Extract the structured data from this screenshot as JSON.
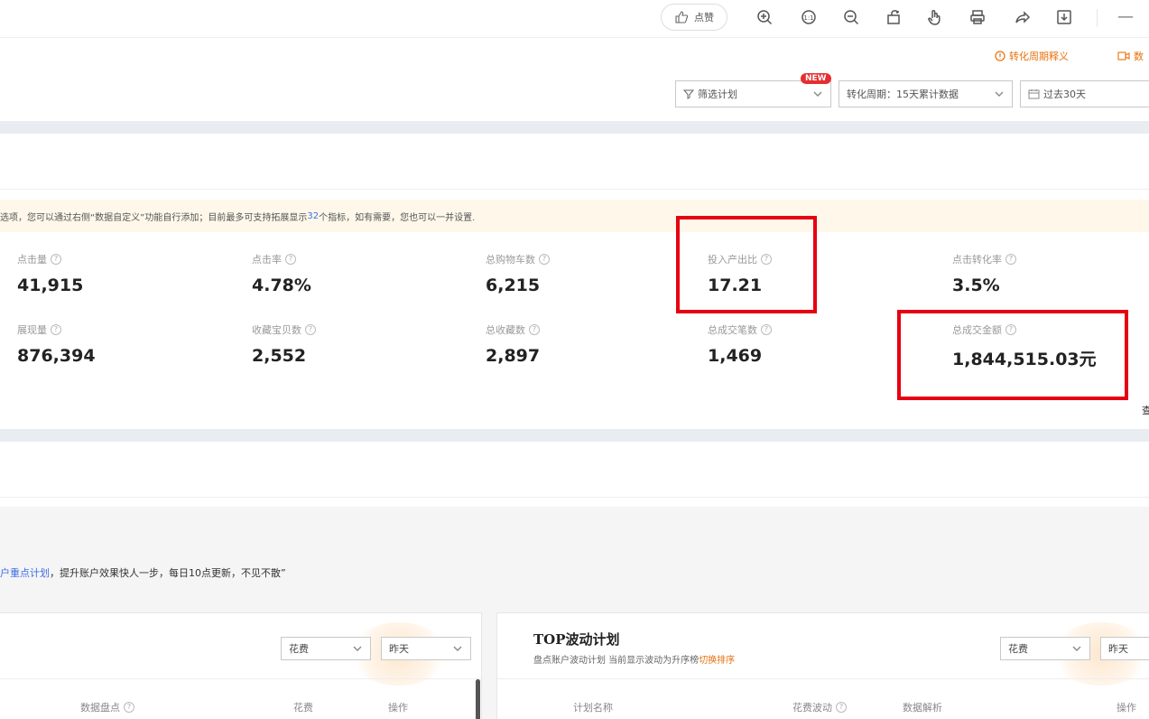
{
  "toolbar": {
    "like_label": "点赞",
    "icons": [
      "zoom-in-icon",
      "fit-icon",
      "zoom-out-icon",
      "rotate-icon",
      "hand-icon",
      "print-icon",
      "share-icon",
      "download-icon"
    ],
    "minus": "—"
  },
  "help": {
    "conversion_explain": "转化周期释义",
    "data_link": "数"
  },
  "filters": {
    "plan_filter": "筛选计划",
    "new_badge": "NEW",
    "period": "转化周期：15天累计数据",
    "date_range": "过去30天"
  },
  "notice": {
    "text_before": "选项，您可以通过右侧“数据自定义”功能自行添加；目前最多可支持拓展显示",
    "highlight": "32",
    "text_after": "个指标，如有需要，您也可以一并设置."
  },
  "metrics": {
    "row1": [
      {
        "label": "点击量",
        "value": "41,915"
      },
      {
        "label": "点击率",
        "value": "4.78%"
      },
      {
        "label": "总购物车数",
        "value": "6,215"
      },
      {
        "label": "投入产出比",
        "value": "17.21"
      },
      {
        "label": "点击转化率",
        "value": "3.5%"
      }
    ],
    "row2": [
      {
        "label": "展现量",
        "value": "876,394"
      },
      {
        "label": "收藏宝贝数",
        "value": "2,552"
      },
      {
        "label": "总收藏数",
        "value": "2,897"
      },
      {
        "label": "总成交笔数",
        "value": "1,469"
      },
      {
        "label": "总成交金额",
        "value": "1,844,515.03元"
      }
    ],
    "edge_char": "查"
  },
  "slogan": {
    "highlight": "户重点计划",
    "text": "，提升账户效果快人一步，每日10点更新，不见不散”"
  },
  "left_panel": {
    "metric_select": "花费",
    "time_select": "昨天",
    "headers": [
      "数据盘点",
      "花费",
      "操作"
    ]
  },
  "right_panel": {
    "title": "TOP波动计划",
    "subtitle_before": "盘点账户波动计划 当前显示波动为升序榜",
    "subtitle_link": "切换排序",
    "metric_select": "花费",
    "time_select": "昨天",
    "headers": [
      "计划名称",
      "花费波动",
      "数据解析",
      "操作"
    ]
  }
}
